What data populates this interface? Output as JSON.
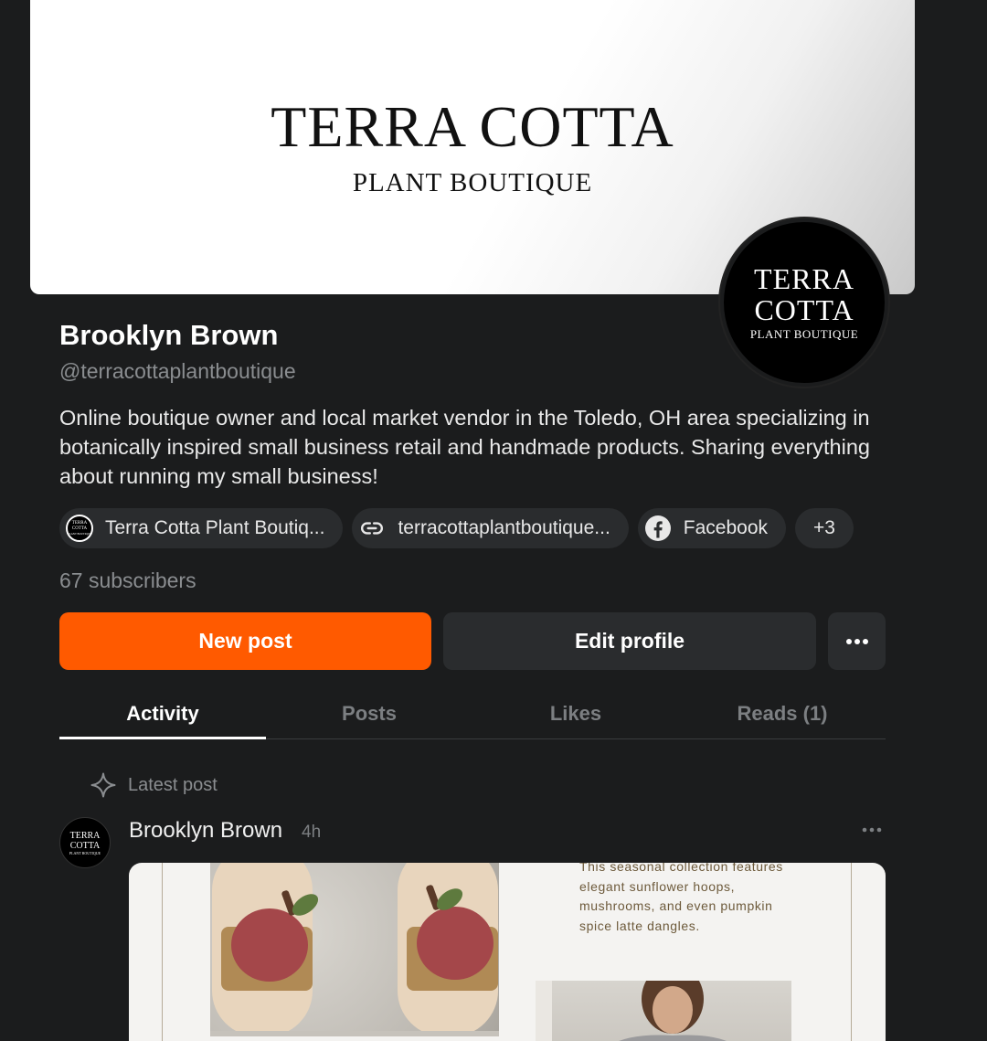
{
  "banner": {
    "title": "TERRA COTTA",
    "subtitle": "PLANT BOUTIQUE"
  },
  "avatar": {
    "line1": "TERRA",
    "line2": "COTTA",
    "line3": "PLANT BOUTIQUE",
    "mini_line1": "TERRA",
    "mini_line2": "COTTA",
    "mini_line3": "PLANT BOUTIQUE"
  },
  "profile": {
    "name": "Brooklyn Brown",
    "handle": "@terracottaplantboutique",
    "bio": "Online boutique owner and local market vendor in the Toledo, OH area specializing in botanically inspired small business retail and handmade products. Sharing everything about running my small business!",
    "subscribers": "67 subscribers"
  },
  "links": [
    {
      "label": "Terra Cotta Plant Boutiq...",
      "icon": "publication-logo-icon"
    },
    {
      "label": "terracottaplantboutique...",
      "icon": "link-icon"
    },
    {
      "label": "Facebook",
      "icon": "facebook-icon"
    },
    {
      "label": "+3",
      "icon": ""
    }
  ],
  "actions": {
    "new_post": "New post",
    "edit_profile": "Edit profile",
    "more_icon": "ellipsis-icon"
  },
  "tabs": [
    {
      "label": "Activity",
      "active": true
    },
    {
      "label": "Posts",
      "active": false
    },
    {
      "label": "Likes",
      "active": false
    },
    {
      "label": "Reads (1)",
      "active": false
    }
  ],
  "feed": {
    "section_label": "Latest post",
    "section_icon": "sparkle-icon",
    "author": "Brooklyn Brown",
    "time": "4h",
    "card_text": "This seasonal collection features elegant sunflower hoops, mushrooms, and even pumpkin spice latte dangles."
  },
  "colors": {
    "background": "#1b1c1d",
    "accent": "#ff5a00",
    "surface": "#2a2c2e",
    "muted_text": "#8a8d90"
  }
}
